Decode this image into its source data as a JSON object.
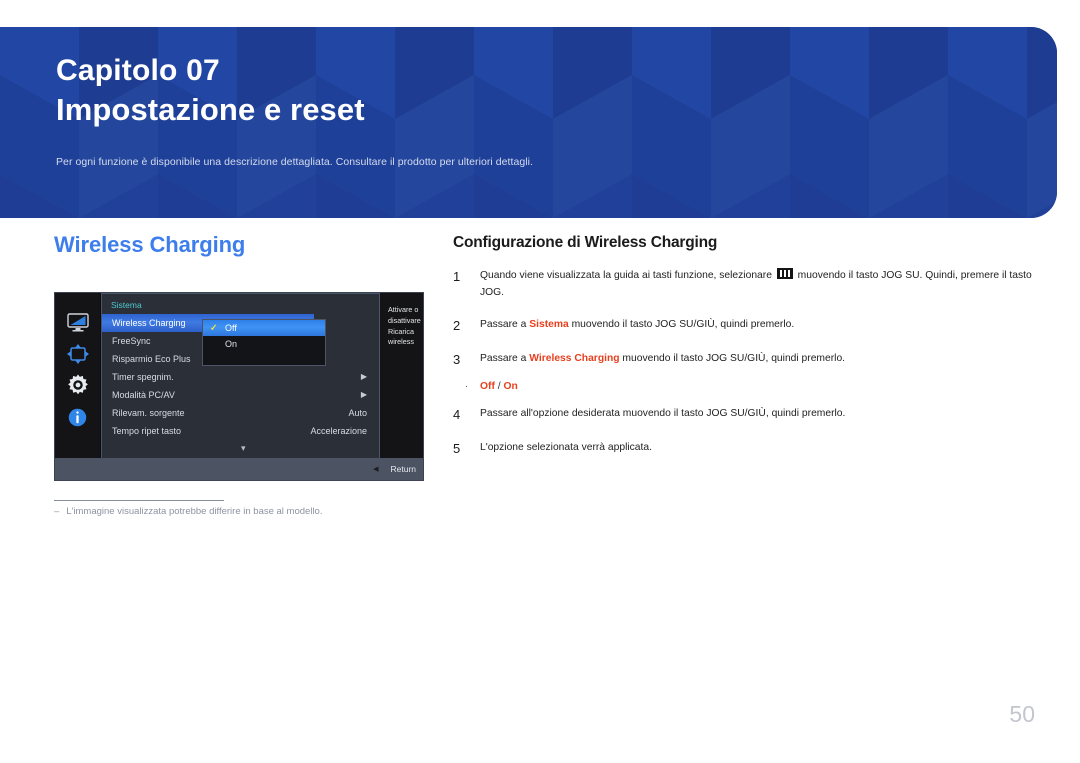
{
  "banner": {
    "chapter_label": "Capitolo 07",
    "chapter_title": "Impostazione e reset",
    "subtitle": "Per ogni funzione è disponibile una descrizione dettagliata. Consultare il prodotto per ulteriori dettagli.",
    "bg_color": "#20409a"
  },
  "section": {
    "title": "Wireless Charging",
    "title_color": "#3d7eec"
  },
  "osd": {
    "section_label": "Sistema",
    "icons": [
      {
        "name": "display-icon",
        "label": "Immagine"
      },
      {
        "name": "screen-adjust-icon",
        "label": "Schermo"
      },
      {
        "name": "system-gear-icon",
        "label": "Sistema"
      },
      {
        "name": "info-icon",
        "label": "Informazioni"
      }
    ],
    "rows": [
      {
        "label": "Wireless Charging",
        "value": "",
        "arrow": false,
        "selected": true
      },
      {
        "label": "FreeSync",
        "value": "",
        "arrow": false,
        "selected": false
      },
      {
        "label": "Risparmio Eco Plus",
        "value": "",
        "arrow": false,
        "selected": false
      },
      {
        "label": "Timer spegnim.",
        "value": "",
        "arrow": true,
        "selected": false
      },
      {
        "label": "Modalità PC/AV",
        "value": "",
        "arrow": true,
        "selected": false
      },
      {
        "label": "Rilevam. sorgente",
        "value": "Auto",
        "arrow": false,
        "selected": false
      },
      {
        "label": "Tempo ripet tasto",
        "value": "Accelerazione",
        "arrow": false,
        "selected": false
      }
    ],
    "scroll_down_glyph": "▾",
    "submenu": {
      "options": [
        {
          "label": "Off",
          "checked": true,
          "selected": true
        },
        {
          "label": "On",
          "checked": false,
          "selected": false
        }
      ],
      "check_glyph": "✓",
      "check_color": "#f2e63a"
    },
    "help_text": "Attivare o disattivare Ricarica wireless",
    "bottom_bar": {
      "back_glyph": "◀",
      "return_label": "Return"
    }
  },
  "footnote": {
    "dash": "‒",
    "text": "L'immagine visualizzata potrebbe differire in base al modello."
  },
  "procedure": {
    "title": "Configurazione di Wireless Charging",
    "steps": [
      {
        "num": "1",
        "pre": "Quando viene visualizzata la guida ai tasti funzione, selezionare ",
        "has_menu_glyph": true,
        "post": " muovendo il tasto JOG SU. Quindi, premere il tasto JOG.",
        "highlight": ""
      },
      {
        "num": "2",
        "pre": "Passare a ",
        "highlight": "Sistema",
        "post": " muovendo il tasto JOG SU/GIÙ, quindi premerlo.",
        "has_menu_glyph": false
      },
      {
        "num": "3",
        "pre": "Passare a ",
        "highlight": "Wireless Charging",
        "post": " muovendo il tasto JOG SU/GIÙ, quindi premerlo.",
        "has_menu_glyph": false
      },
      {
        "num": "4",
        "pre": "Passare all'opzione desiderata muovendo il tasto JOG SU/GIÙ, quindi premerlo.",
        "highlight": "",
        "post": "",
        "has_menu_glyph": false
      },
      {
        "num": "5",
        "pre": "L'opzione selezionata verrà applicata.",
        "highlight": "",
        "post": "",
        "has_menu_glyph": false
      }
    ],
    "bullet": {
      "dot": "·",
      "option_off": "Off",
      "separator": " / ",
      "option_on": "On",
      "color": "#e8401f"
    }
  },
  "page_number": "50"
}
